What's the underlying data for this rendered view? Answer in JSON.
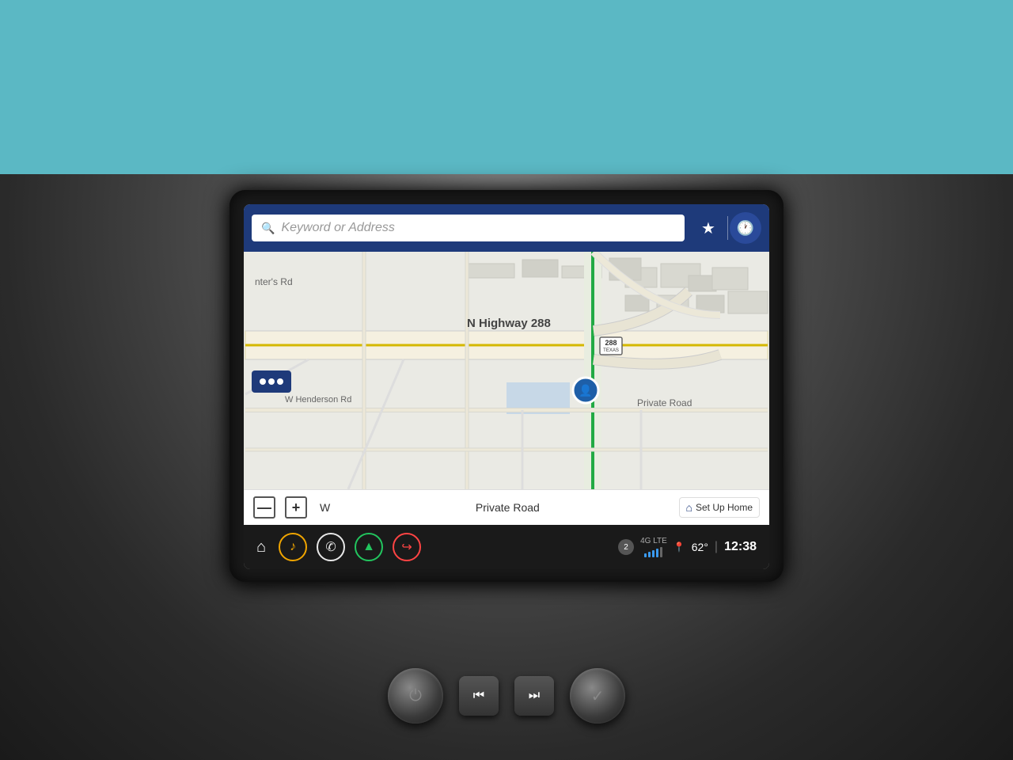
{
  "screen": {
    "search": {
      "placeholder": "Keyword or Address",
      "favorites_label": "★",
      "recent_label": "🕐"
    },
    "map": {
      "highway_label": "N Highway 288",
      "highway_number": "288",
      "highway_state": "TEXAS",
      "road1": "W Henderson Rd",
      "road2": "Private Road",
      "compass": "W"
    },
    "bottom_bar": {
      "zoom_minus": "—",
      "zoom_plus": "+",
      "compass": "W",
      "road": "Private Road",
      "setup_home": "Set Up Home"
    },
    "nav_bar": {
      "home_icon": "⌂",
      "music_icon": "♪",
      "phone_icon": "✆",
      "nav_icon": "▲",
      "app_icon": "↪"
    },
    "status": {
      "signal_num": "2",
      "lte": "4G LTE",
      "temp": "62°",
      "time": "12:38"
    }
  },
  "controls": {
    "power_label": "⏻",
    "prev_label": "⏮",
    "next_label": "⏭",
    "check_label": "✓"
  }
}
